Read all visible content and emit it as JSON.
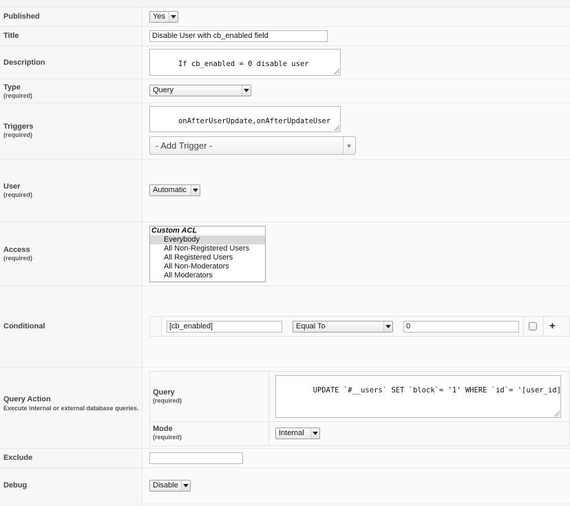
{
  "fields": {
    "published": {
      "label": "Published",
      "value": "Yes"
    },
    "title": {
      "label": "Title",
      "value": "Disable User with cb_enabled field"
    },
    "description": {
      "label": "Description",
      "value": "If cb_enabled = 0 disable user"
    },
    "type": {
      "label": "Type",
      "required": "(required)",
      "value": "Query"
    },
    "triggers": {
      "label": "Triggers",
      "required": "(required)",
      "value": "onAfterUserUpdate,onAfterUpdateUser",
      "add_placeholder": "- Add Trigger -"
    },
    "user": {
      "label": "User",
      "required": "(required)",
      "value": "Automatic"
    },
    "access": {
      "label": "Access",
      "required": "(required)",
      "group": "Custom ACL",
      "options": [
        "Everybody",
        "All Non-Registered Users",
        "All Registered Users",
        "All Non-Moderators",
        "All Moderators"
      ],
      "selected": "Everybody"
    },
    "conditional": {
      "label": "Conditional",
      "field": "[cb_enabled]",
      "operator": "Equal To",
      "value": "0",
      "add_icon": "+"
    },
    "query_action": {
      "label": "Query Action",
      "description": "Execute internal or external database queries.",
      "query_label": "Query",
      "query_required": "(required)",
      "query_value": "UPDATE `#__users` SET `block`= '1' WHERE `id`= '[user_id]'",
      "mode_label": "Mode",
      "mode_required": "(required)",
      "mode_value": "Internal"
    },
    "exclude": {
      "label": "Exclude",
      "value": ""
    },
    "debug": {
      "label": "Debug",
      "value": "Disable"
    }
  },
  "icons": {
    "add": "plus-icon",
    "dropdown": "chevron-down-icon",
    "resize": "resize-grip-icon"
  }
}
